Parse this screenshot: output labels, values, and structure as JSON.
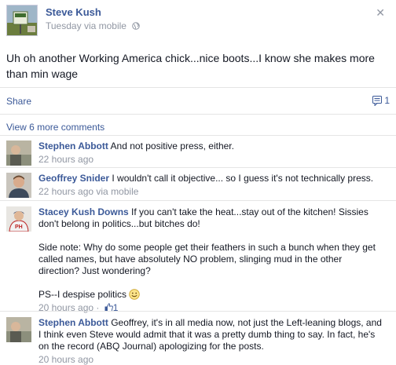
{
  "post": {
    "author": "Steve Kush",
    "time": "Tuesday",
    "via": "via mobile",
    "body": "Uh oh another Working America chick...nice boots...I know she makes more than min wage",
    "close_glyph": "✕",
    "avatar_icon": "profile-photo"
  },
  "actions": {
    "share_label": "Share",
    "comment_count": "1"
  },
  "view_more_label": "View 6 more comments",
  "comments": [
    {
      "author": "Stephen Abbott",
      "text": "And not positive press, either.",
      "meta": "22 hours ago"
    },
    {
      "author": "Geoffrey Snider",
      "text": "I wouldn't call it objective... so I guess it's not technically press.",
      "meta": "22 hours ago via mobile"
    },
    {
      "author": "Stacey Kush Downs",
      "text": "If you can't take the heat...stay out of the kitchen! Sissies don't belong in politics...but bitches do!",
      "para2": "Side note: Why do some people get their feathers in such a bunch when they get called names, but have absolutely NO problem, slinging mud in the other direction? Just wondering?",
      "para3": "PS--I despise politics",
      "meta": "20 hours ago",
      "meta_sep": " · ",
      "likes": "1"
    },
    {
      "author": "Stephen Abbott",
      "text": "Geoffrey, it's in all media now, not just the Left-leaning blogs, and I think even Steve would admit that it was a pretty dumb thing to say. In fact, he's on the record (ABQ Journal) apologizing for the posts.",
      "meta": "20 hours ago"
    }
  ],
  "colors": {
    "link": "#3b5998",
    "meta": "#9197a3",
    "text": "#141823",
    "divider": "#e5e5e5"
  }
}
